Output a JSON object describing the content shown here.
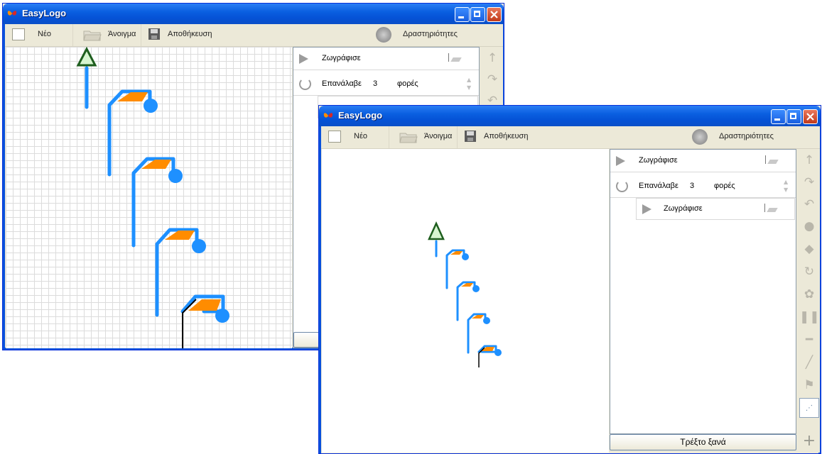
{
  "window_back": {
    "title": "EasyLogo",
    "toolbar": {
      "new_label": "Νέο",
      "open_label": "Άνοιγμα",
      "save_label": "Αποθήκευση",
      "activities_label": "Δραστηριότητες"
    },
    "program": {
      "draw_label": "Ζωγράφισε",
      "repeat_label": "Επανάλαβε",
      "repeat_count": "3",
      "times_label": "φορές"
    }
  },
  "window_front": {
    "title": "EasyLogo",
    "toolbar": {
      "new_label": "Νέο",
      "open_label": "Άνοιγμα",
      "save_label": "Αποθήκευση",
      "activities_label": "Δραστηριότητες"
    },
    "program": {
      "draw_label": "Ζωγράφισε",
      "repeat_label": "Επανάλαβε",
      "repeat_count": "3",
      "times_label": "φορές",
      "inner_draw_label": "Ζωγράφισε"
    },
    "run_again_label": "Τρέξτο ξανά"
  },
  "icons": [
    "app-butterfly-icon",
    "minimize-icon",
    "maximize-icon",
    "close-icon",
    "new-file-icon",
    "open-folder-icon",
    "save-disk-icon",
    "activities-icon",
    "play-icon",
    "repeat-icon",
    "flag-icon",
    "up-arrow-icon",
    "redo-icon",
    "undo-icon",
    "dot-icon",
    "fill-icon",
    "rotate-icon",
    "flower-icon",
    "pause-icon",
    "line-icon",
    "pen-icon",
    "dotted-icon",
    "add-icon"
  ],
  "colors": {
    "turtle_line": "#1e90ff",
    "flag_fill": "#ff8c00",
    "title_bar": "#0a5fe0",
    "turtle": "#1e6e1e"
  }
}
